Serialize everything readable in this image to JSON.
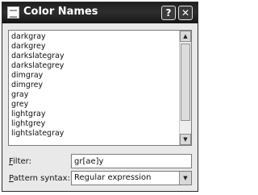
{
  "window": {
    "title": "Color Names",
    "help_glyph": "?",
    "close_glyph": "✕"
  },
  "list": {
    "items": [
      "darkgray",
      "darkgrey",
      "darkslategray",
      "darkslategrey",
      "dimgray",
      "dimgrey",
      "gray",
      "grey",
      "lightgray",
      "lightgrey",
      "lightslategray"
    ]
  },
  "scrollbar": {
    "up_glyph": "▲",
    "down_glyph": "▼"
  },
  "filter": {
    "label_key": "F",
    "label_rest": "ilter:",
    "value": "gr[ae]y"
  },
  "syntax": {
    "label_key": "P",
    "label_rest": "attern syntax:",
    "value": "Regular expression",
    "arrow_glyph": "▼"
  },
  "icons": {
    "app": "window-app-icon",
    "help": "help-icon",
    "close": "close-icon",
    "scroll_up": "scroll-up-arrow-icon",
    "scroll_down": "scroll-down-arrow-icon",
    "dropdown": "chevron-down-icon"
  }
}
